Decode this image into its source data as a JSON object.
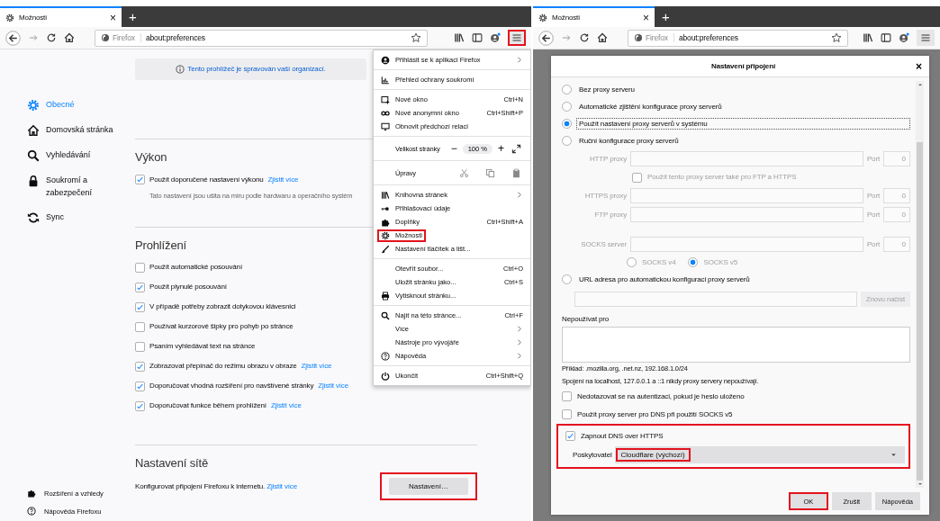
{
  "left_window": {
    "tab": {
      "title": "Možnosti",
      "close": "×",
      "selected": true
    },
    "new_tab": "+",
    "identity": "Firefox",
    "address": "about:preferences",
    "menu_button": {
      "highlighted": true
    },
    "notice": "Tento prohlížeč je spravován vaší organizací.",
    "sidebar": {
      "items": [
        {
          "label": "Obecné",
          "selected": true
        },
        {
          "label": "Domovská stránka",
          "selected": false
        },
        {
          "label": "Vyhledávání",
          "selected": false
        },
        {
          "label": "Soukromí a zabezpečení",
          "selected": false
        },
        {
          "label": "Sync",
          "selected": false
        }
      ],
      "footer": [
        {
          "label": "Rozšíření a vzhledy"
        },
        {
          "label": "Nápověda Firefoxu"
        }
      ]
    },
    "sections": [
      {
        "title": "Výkon",
        "options": [
          {
            "label": "Použít doporučené nastavení výkonu",
            "checked": true,
            "link": "Zjistit více"
          }
        ],
        "note": "Tato nastavení jsou ušita na míru podle hardwaru a operačního systém"
      },
      {
        "title": "Prohlížení",
        "options": [
          {
            "label": "Použít automatické posouvání",
            "checked": false
          },
          {
            "label": "Použít plynulé posouvání",
            "checked": true
          },
          {
            "label": "V případě potřeby zobrazit dotykovou klávesnici",
            "checked": true
          },
          {
            "label": "Používat kurzorové šipky pro pohyb po stránce",
            "checked": false
          },
          {
            "label": "Psaním vyhledávat text na stránce",
            "checked": false
          },
          {
            "label": "Zobrazovat přepínač do režimu obrazu v obraze",
            "checked": true,
            "link": "Zjistit více"
          },
          {
            "label": "Doporučovat vhodná rozšíření pro navštívené stránky",
            "checked": true,
            "link": "Zjistit více"
          },
          {
            "label": "Doporučovat funkce během prohlížení",
            "checked": true,
            "link": "Zjistit více"
          }
        ]
      }
    ],
    "network": {
      "title": "Nastavení sítě",
      "text": "Konfigurovat připojení Firefoxu k internetu.",
      "link": "Zjistit více",
      "button": "Nastavení…",
      "highlighted": true
    },
    "menu": {
      "items": [
        {
          "kind": "item",
          "label": "Přihlásit se k aplikaci Firefox",
          "submenu": true,
          "highlighted": false
        },
        {
          "kind": "separator"
        },
        {
          "kind": "item",
          "label": "Přehled ochrany soukromí",
          "submenu": false,
          "highlighted": false
        },
        {
          "kind": "separator"
        },
        {
          "kind": "item",
          "label": "Nové okno",
          "shortcut": "Ctrl+N",
          "submenu": false,
          "highlighted": false
        },
        {
          "kind": "item",
          "label": "Nové anonymní okno",
          "shortcut": "Ctrl+Shift+P",
          "submenu": false,
          "highlighted": false
        },
        {
          "kind": "item",
          "label": "Obnovit předchozí relaci",
          "submenu": false,
          "highlighted": false
        },
        {
          "kind": "separator"
        },
        {
          "kind": "zoom",
          "label": "Velikost stránky",
          "minus": "−",
          "value": "100 %",
          "plus": "+"
        },
        {
          "kind": "separator"
        },
        {
          "kind": "edit",
          "label": "Úpravy"
        },
        {
          "kind": "separator"
        },
        {
          "kind": "item",
          "label": "Knihovna stránek",
          "submenu": true,
          "highlighted": false
        },
        {
          "kind": "item",
          "label": "Přihlašovací údaje",
          "submenu": false,
          "highlighted": false
        },
        {
          "kind": "item",
          "label": "Doplňky",
          "shortcut": "Ctrl+Shift+A",
          "submenu": false,
          "highlighted": false
        },
        {
          "kind": "item",
          "label": "Možnosti",
          "submenu": false,
          "highlighted": true
        },
        {
          "kind": "item",
          "label": "Nastavení tlačítek a lišt...",
          "submenu": false,
          "highlighted": false
        },
        {
          "kind": "separator"
        },
        {
          "kind": "item",
          "label": "Otevřít soubor...",
          "shortcut": "Ctrl+O",
          "submenu": false,
          "highlighted": false
        },
        {
          "kind": "item",
          "label": "Uložit stránku jako...",
          "shortcut": "Ctrl+S",
          "submenu": false,
          "highlighted": false
        },
        {
          "kind": "item",
          "label": "Vytisknout stránku...",
          "submenu": false,
          "highlighted": false
        },
        {
          "kind": "separator"
        },
        {
          "kind": "item",
          "label": "Najít na této stránce...",
          "shortcut": "Ctrl+F",
          "submenu": false,
          "highlighted": false
        },
        {
          "kind": "item",
          "label": "Více",
          "submenu": true,
          "highlighted": false
        },
        {
          "kind": "item",
          "label": "Nástroje pro vývojáře",
          "submenu": true,
          "highlighted": false
        },
        {
          "kind": "item",
          "label": "Nápověda",
          "submenu": true,
          "highlighted": false
        },
        {
          "kind": "separator"
        },
        {
          "kind": "item",
          "label": "Ukončit",
          "shortcut": "Ctrl+Shift+Q",
          "submenu": false,
          "highlighted": false
        }
      ]
    }
  },
  "right_window": {
    "tab": {
      "title": "Možnosti",
      "close": "×",
      "selected": true
    },
    "new_tab": "+",
    "identity": "Firefox",
    "address": "about:preferences",
    "menu_button": {
      "highlighted": false
    },
    "dialog": {
      "title": "Nastavení připojení",
      "close": "×",
      "proxy_modes": [
        {
          "label": "Bez proxy serveru",
          "selected": false,
          "focused": false
        },
        {
          "label": "Automatické zjištění konfigurace proxy serverů",
          "selected": false,
          "focused": false
        },
        {
          "label": "Použít nastavení proxy serverů v systému",
          "selected": true,
          "focused": true
        },
        {
          "label": "Ruční konfigurace proxy serverů",
          "selected": false,
          "focused": false
        }
      ],
      "manual_fields": {
        "disabled": true,
        "rows": [
          {
            "label": "HTTP proxy",
            "port_label": "Port",
            "port": "0"
          },
          {
            "label": "HTTPS proxy",
            "port_label": "Port",
            "port": "0"
          },
          {
            "label": "FTP proxy",
            "port_label": "Port",
            "port": "0"
          },
          {
            "label": "SOCKS server",
            "port_label": "Port",
            "port": "0"
          }
        ],
        "share": {
          "label": "Použít tento proxy server také pro FTP a HTTPS",
          "checked": false
        },
        "socks_versions": [
          {
            "label": "SOCKS v4",
            "selected": false
          },
          {
            "label": "SOCKS v5",
            "selected": true
          }
        ]
      },
      "auto_url": {
        "label": "URL adresa pro automatickou konfiguraci proxy serverů",
        "selected": false,
        "button": "Znovu načíst",
        "disabled": true
      },
      "no_proxy": {
        "label": "Nepoužívat pro"
      },
      "hints": [
        "Příklad: .mozilla.org, .net.nz, 192.168.1.0/24",
        "Spojení na localhost, 127.0.0.1 a ::1 nikdy proxy servery nepoužívají."
      ],
      "options": [
        {
          "label": "Nedotazovat se na autentizaci, pokud je heslo uloženo",
          "checked": false
        },
        {
          "label": "Použít proxy server pro DNS při použití SOCKS v5",
          "checked": false
        }
      ],
      "doh": {
        "label": "Zapnout DNS over HTTPS",
        "checked": true,
        "highlighted": true
      },
      "provider": {
        "label": "Poskytovatel",
        "value": "Cloudflare (výchozí)",
        "highlighted": true
      },
      "buttons": [
        {
          "label": "OK",
          "highlighted": true
        },
        {
          "label": "Zrušit",
          "highlighted": false
        },
        {
          "label": "Nápověda",
          "highlighted": false
        }
      ]
    }
  }
}
